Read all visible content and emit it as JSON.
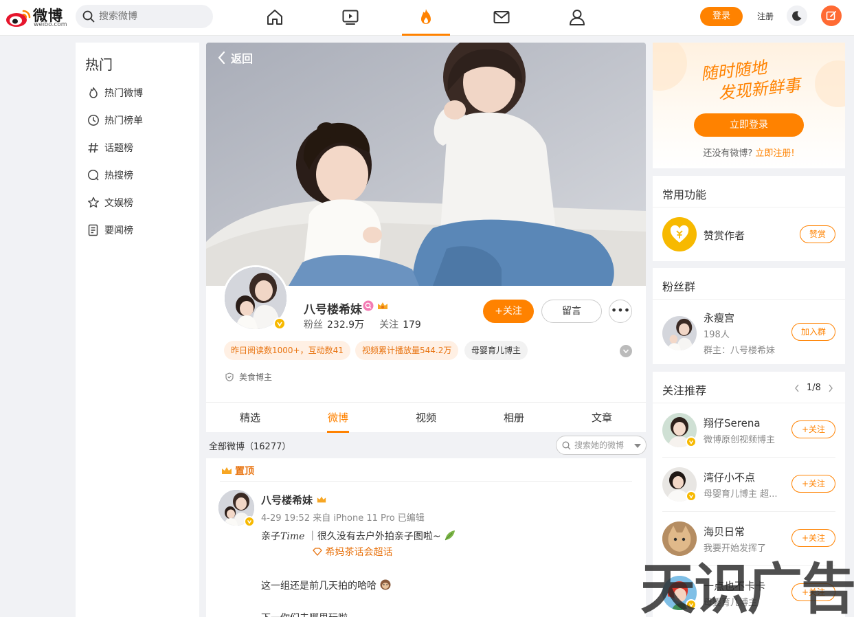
{
  "header": {
    "logo_text": "微博",
    "logo_sub": "weibo.com",
    "search_placeholder": "搜索微博",
    "login_label": "登录",
    "register_label": "注册"
  },
  "sidebar": {
    "title": "热门",
    "items": [
      {
        "label": "热门微博",
        "icon": "flame-outline-icon"
      },
      {
        "label": "热门榜单",
        "icon": "clock-icon"
      },
      {
        "label": "话题榜",
        "icon": "hashtag-icon"
      },
      {
        "label": "热搜榜",
        "icon": "search-circle-icon"
      },
      {
        "label": "文娱榜",
        "icon": "star-icon"
      },
      {
        "label": "要闻榜",
        "icon": "news-icon"
      }
    ]
  },
  "profile": {
    "back_label": "返回",
    "name": "八号楼希妹",
    "fans_label": "粉丝",
    "fans_value": "232.9万",
    "following_label": "关注",
    "following_value": "179",
    "follow_button": "+关注",
    "message_button": "留言",
    "more_button": "•••",
    "tags": [
      "昨日阅读数1000+，互动数41",
      "视频累计播放量544.2万",
      "母婴育儿博主"
    ],
    "certification": "美食博主"
  },
  "tabs": [
    "精选",
    "微博",
    "视频",
    "相册",
    "文章"
  ],
  "active_tab": "微博",
  "feed": {
    "all_label": "全部微博（16277）",
    "search_placeholder": "搜索她的微博",
    "pinned_label": "置顶",
    "post": {
      "author": "八号楼希妹",
      "meta": "4-29 19:52 来自 iPhone 11 Pro 已编辑",
      "text_line1_prefix": "亲子",
      "text_line1_italic": "Time",
      "text_line1_rest": "  ｜很久没有去户外拍亲子图啦~",
      "topic": "希妈茶话会超话",
      "text_line2": "这一组还是前几天拍的哈哈",
      "text_line3": "下一你们去哪里玩啦"
    }
  },
  "promo": {
    "slogan_line1": "随时随地",
    "slogan_line2": "发现新鲜事",
    "login_button": "立即登录",
    "hint_prefix": "还没有微博?",
    "hint_link": "立即注册!"
  },
  "common_functions": {
    "title": "常用功能",
    "item_label": "赞赏作者",
    "item_button": "赞赏"
  },
  "fan_group": {
    "title": "粉丝群",
    "name": "永瘦宫",
    "members": "198人",
    "owner": "群主：八号楼希妹",
    "join_button": "加入群"
  },
  "recommend": {
    "title": "关注推荐",
    "page": "1/8",
    "follow_label": "+关注",
    "users": [
      {
        "name": "翔仔Serena",
        "desc": "微博原创视频博主"
      },
      {
        "name": "湾仔小不点",
        "desc": "母婴育儿博主 超..."
      },
      {
        "name": "海贝日常",
        "desc": "我要开始发挥了"
      },
      {
        "name": "一点也不卡卡",
        "desc": "母婴育儿博主"
      }
    ]
  },
  "watermark": "天识广告",
  "colors": {
    "accent": "#ff8200",
    "tag_bg": "#fff0e4",
    "tag_text": "#e8730f"
  }
}
